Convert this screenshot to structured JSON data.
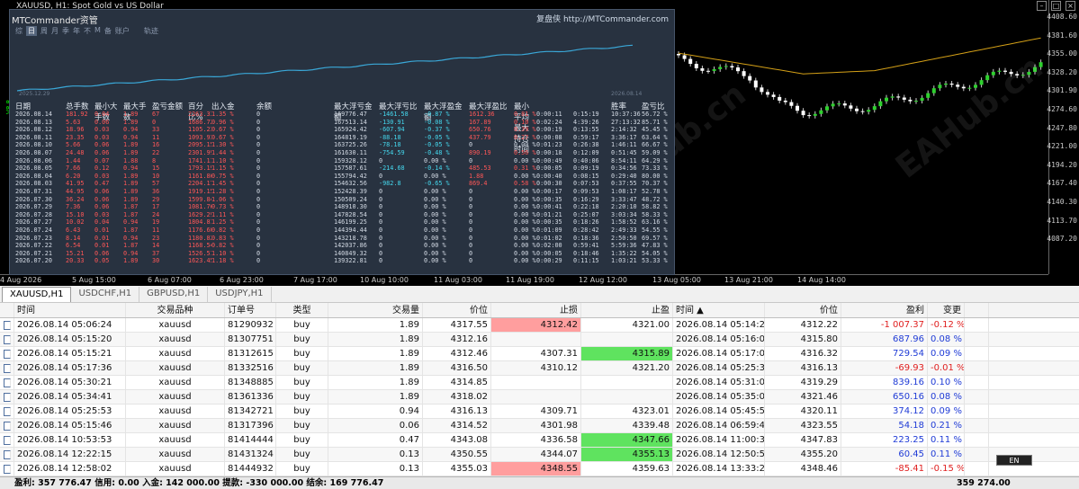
{
  "chart": {
    "title": "XAUUSD, H1:  Spot Gold vs US Dollar",
    "y_ticks": [
      "4408.60",
      "4381.60",
      "4355.00",
      "4328.20",
      "4301.90",
      "4274.60",
      "4247.80",
      "4221.00",
      "4194.20",
      "4167.40",
      "4140.30",
      "4113.70",
      "4087.20"
    ],
    "x_ticks": [
      "4 Aug 2026",
      "5 Aug 15:00",
      "6 Aug 07:00",
      "6 Aug 23:00",
      "7 Aug 17:00",
      "10 Aug 10:00",
      "11 Aug 03:00",
      "11 Aug 19:00",
      "12 Aug 12:00",
      "13 Aug 05:00",
      "13 Aug 21:00",
      "14 Aug 14:00"
    ],
    "watermark": "EAHub.cn",
    "left_tag": "V8.8"
  },
  "panel": {
    "brand": "MTCommander资管",
    "link": "复盘侠 http://MTCommander.com",
    "menu": [
      "综",
      "日",
      "周",
      "月",
      "季",
      "年",
      "不",
      "M",
      "备",
      "账户",
      "轨迹"
    ],
    "menu_active": "日",
    "eq_start": "2025.12.29",
    "eq_end": "2026.08.14",
    "headers": [
      "日期",
      "总手数",
      "最小大手数",
      "最大手数",
      "盈亏金额",
      "百分比%",
      "出入金",
      "余额",
      "最大浮亏金额",
      "最大浮亏比",
      "最大浮盈金额",
      "最大浮盈比",
      "最小平均最大持仓时间",
      "",
      "",
      "胜率",
      "盈亏比"
    ],
    "rows": [
      [
        "2026.08.14",
        "181.92",
        "0.04",
        "1.89",
        "67",
        "2263.33",
        "1.35 %",
        "0",
        "169776.47",
        "-1461.58",
        "-0.87 %",
        "1612.36",
        "0.81 %",
        "0:00:11",
        "0:15:19",
        "10:37:36",
        "56.72 %",
        "0.50"
      ],
      [
        "2026.08.13",
        "5.63",
        "0.06",
        "1.89",
        "0",
        "1686.72",
        "0.96 %",
        "0",
        "167513.14",
        "-130.91",
        "-0.08 %",
        "167.89",
        "0.10 %",
        "0:02:24",
        "4:39:26",
        "27:13:32",
        "85.71 %",
        "0.17"
      ],
      [
        "2026.08.12",
        "18.96",
        "0.03",
        "0.94",
        "33",
        "1105.23",
        "0.67 %",
        "0",
        "165924.42",
        "-607.94",
        "-0.37 %",
        "650.76",
        "0.39 %",
        "0:00:19",
        "0:13:55",
        "2:14:32",
        "45.45 %",
        "1.05"
      ],
      [
        "2026.08.11",
        "23.35",
        "0.03",
        "0.94",
        "11",
        "1093.93",
        "0.67 %",
        "0",
        "164819.19",
        "-88.18",
        "-0.05 %",
        "437.79",
        "0.27 %",
        "0:00:08",
        "0:59:17",
        "3:36:17",
        "63.64 %",
        "1.67"
      ],
      [
        "2026.08.10",
        "5.66",
        "0.06",
        "1.89",
        "16",
        "2095.15",
        "1.30 %",
        "0",
        "163725.26",
        "-78.18",
        "-0.05 %",
        "0",
        "0.00 %",
        "0:01:23",
        "0:26:38",
        "1:46:11",
        "66.67 %",
        "1.13"
      ],
      [
        "2026.08.07",
        "24.48",
        "0.06",
        "1.89",
        "22",
        "2301.99",
        "1.44 %",
        "0",
        "161630.11",
        "-754.59",
        "-0.48 %",
        "890.19",
        "0.56 %",
        "0:00:18",
        "0:12:09",
        "0:51:45",
        "59.09 %",
        "1.20"
      ],
      [
        "2026.08.06",
        "1.44",
        "0.07",
        "1.88",
        "8",
        "1741.11",
        "1.10 %",
        "0",
        "159328.12",
        "0",
        "0.00 %",
        "0",
        "0.00 %",
        "0:00:49",
        "0:40:06",
        "8:54:11",
        "64.29 %",
        "1.00"
      ],
      [
        "2026.08.05",
        "7.66",
        "0.12",
        "0.94",
        "15",
        "1793.19",
        "1.15 %",
        "0",
        "157587.61",
        "-214.68",
        "-0.14 %",
        "485.53",
        "0.31 %",
        "0:00:05",
        "0:09:19",
        "0:34:56",
        "73.33 %",
        "8.24"
      ],
      [
        "2026.08.04",
        "6.20",
        "0.03",
        "1.89",
        "10",
        "1161.86",
        "0.75 %",
        "0",
        "155794.42",
        "0",
        "0.00 %",
        "1.88",
        "0.00 %",
        "0:00:40",
        "0:08:15",
        "0:29:40",
        "80.00 %",
        "0.45"
      ],
      [
        "2026.08.03",
        "41.95",
        "0.47",
        "1.89",
        "57",
        "2204.17",
        "1.45 %",
        "0",
        "154632.56",
        "-982.8",
        "-0.65 %",
        "869.4",
        "0.58 %",
        "0:00:30",
        "0:07:53",
        "0:37:55",
        "70.37 %",
        "0.56"
      ],
      [
        "2026.07.31",
        "44.95",
        "0.06",
        "1.89",
        "36",
        "1919.15",
        "1.28 %",
        "0",
        "152428.39",
        "0",
        "0.00 %",
        "0",
        "0.00 %",
        "0:00:17",
        "0:09:53",
        "1:08:17",
        "52.78 %",
        "0.54"
      ],
      [
        "2026.07.30",
        "36.24",
        "0.06",
        "1.89",
        "29",
        "1599.84",
        "1.06 %",
        "0",
        "150509.24",
        "0",
        "0.00 %",
        "0",
        "0.00 %",
        "0:00:35",
        "0:16:29",
        "3:33:47",
        "48.72 %",
        "0.61"
      ],
      [
        "2026.07.29",
        "7.36",
        "0.06",
        "1.87",
        "17",
        "1081.76",
        "0.73 %",
        "0",
        "148910.30",
        "0",
        "0.00 %",
        "0",
        "0.00 %",
        "0:00:41",
        "0:22:18",
        "2:20:10",
        "58.82 %",
        "0.61"
      ],
      [
        "2026.07.28",
        "15.10",
        "0.03",
        "1.87",
        "24",
        "1629.29",
        "1.11 %",
        "0",
        "147828.54",
        "0",
        "0.00 %",
        "0",
        "0.00 %",
        "0:01:21",
        "0:25:07",
        "3:03:34",
        "58.33 %",
        "0.47"
      ],
      [
        "2026.07.27",
        "10.02",
        "0.04",
        "0.94",
        "19",
        "1804.81",
        "1.25 %",
        "0",
        "146199.25",
        "0",
        "0.00 %",
        "0",
        "0.00 %",
        "0:00:35",
        "0:18:26",
        "1:58:52",
        "63.16 %",
        "0.52"
      ],
      [
        "2026.07.24",
        "6.43",
        "0.01",
        "1.87",
        "11",
        "1176.60",
        "0.82 %",
        "0",
        "144394.44",
        "0",
        "0.00 %",
        "0",
        "0.00 %",
        "0:01:09",
        "0:28:42",
        "2:49:33",
        "54.55 %",
        "0.76"
      ],
      [
        "2026.07.23",
        "8.14",
        "0.01",
        "0.94",
        "23",
        "1180.82",
        "0.83 %",
        "0",
        "143218.78",
        "0",
        "0.00 %",
        "0",
        "0.00 %",
        "0:01:02",
        "0:18:36",
        "2:50:50",
        "69.57 %",
        "0.71"
      ],
      [
        "2026.07.22",
        "6.54",
        "0.01",
        "1.87",
        "14",
        "1168.54",
        "0.82 %",
        "0",
        "142037.86",
        "0",
        "0.00 %",
        "0",
        "0.00 %",
        "0:02:00",
        "0:59:41",
        "5:59:36",
        "47.83 %",
        "0.66"
      ],
      [
        "2026.07.21",
        "15.21",
        "0.06",
        "0.94",
        "37",
        "1526.51",
        "1.10 %",
        "0",
        "140849.32",
        "0",
        "0.00 %",
        "0",
        "0.00 %",
        "0:00:05",
        "0:18:46",
        "1:35:22",
        "54.05 %",
        "0.78"
      ],
      [
        "2026.07.20",
        "20.33",
        "0.05",
        "1.89",
        "30",
        "1623.45",
        "1.18 %",
        "0",
        "139322.81",
        "0",
        "0.00 %",
        "0",
        "0.00 %",
        "0:00:29",
        "0:11:15",
        "1:03:21",
        "53.33 %",
        "0.78"
      ]
    ]
  },
  "tabs": [
    "XAUUSD,H1",
    "USDCHF,H1",
    "GBPUSD,H1",
    "USDJPY,H1"
  ],
  "tabs_active": 0,
  "table": {
    "headers": [
      "时间",
      "交易品种",
      "订单号",
      "类型",
      "交易量",
      "价位",
      "止损",
      "止盈",
      "时间",
      "价位",
      "盈利",
      "变更"
    ],
    "sort_marker": "▲",
    "rows": [
      {
        "t": "2026.08.14 05:06:24",
        "s": "xauusd",
        "o": "81290932",
        "ty": "buy",
        "v": "1.89",
        "p": "4317.55",
        "sl": "4312.42",
        "tp": "4321.00",
        "ct": "2026.08.14 05:14:26",
        "cp": "4312.22",
        "pr": "-1 007.37",
        "ch": "-0.12 %",
        "slbg": "red",
        "tpbg": "",
        "pos": false
      },
      {
        "t": "2026.08.14 05:15:20",
        "s": "xauusd",
        "o": "81307751",
        "ty": "buy",
        "v": "1.89",
        "p": "4312.16",
        "sl": "",
        "tp": "",
        "ct": "2026.08.14 05:16:07",
        "cp": "4315.80",
        "pr": "687.96",
        "ch": "0.08 %",
        "slbg": "",
        "tpbg": "",
        "pos": true
      },
      {
        "t": "2026.08.14 05:15:21",
        "s": "xauusd",
        "o": "81312615",
        "ty": "buy",
        "v": "1.89",
        "p": "4312.46",
        "sl": "4307.31",
        "tp": "4315.89",
        "ct": "2026.08.14 05:17:05",
        "cp": "4316.32",
        "pr": "729.54",
        "ch": "0.09 %",
        "slbg": "",
        "tpbg": "green",
        "pos": true
      },
      {
        "t": "2026.08.14 05:17:36",
        "s": "xauusd",
        "o": "81332516",
        "ty": "buy",
        "v": "1.89",
        "p": "4316.50",
        "sl": "4310.12",
        "tp": "4321.20",
        "ct": "2026.08.14 05:25:36",
        "cp": "4316.13",
        "pr": "-69.93",
        "ch": "-0.01 %",
        "slbg": "",
        "tpbg": "",
        "pos": false
      },
      {
        "t": "2026.08.14 05:30:21",
        "s": "xauusd",
        "o": "81348885",
        "ty": "buy",
        "v": "1.89",
        "p": "4314.85",
        "sl": "",
        "tp": "",
        "ct": "2026.08.14 05:31:01",
        "cp": "4319.29",
        "pr": "839.16",
        "ch": "0.10 %",
        "slbg": "",
        "tpbg": "",
        "pos": true
      },
      {
        "t": "2026.08.14 05:34:41",
        "s": "xauusd",
        "o": "81361336",
        "ty": "buy",
        "v": "1.89",
        "p": "4318.02",
        "sl": "",
        "tp": "",
        "ct": "2026.08.14 05:35:02",
        "cp": "4321.46",
        "pr": "650.16",
        "ch": "0.08 %",
        "slbg": "",
        "tpbg": "",
        "pos": true
      },
      {
        "t": "2026.08.14 05:25:53",
        "s": "xauusd",
        "o": "81342721",
        "ty": "buy",
        "v": "0.94",
        "p": "4316.13",
        "sl": "4309.71",
        "tp": "4323.01",
        "ct": "2026.08.14 05:45:58",
        "cp": "4320.11",
        "pr": "374.12",
        "ch": "0.09 %",
        "slbg": "",
        "tpbg": "",
        "pos": true
      },
      {
        "t": "2026.08.14 05:15:46",
        "s": "xauusd",
        "o": "81317396",
        "ty": "buy",
        "v": "0.06",
        "p": "4314.52",
        "sl": "4301.98",
        "tp": "4339.48",
        "ct": "2026.08.14 06:59:44",
        "cp": "4323.55",
        "pr": "54.18",
        "ch": "0.21 %",
        "slbg": "",
        "tpbg": "",
        "pos": true
      },
      {
        "t": "2026.08.14 10:53:53",
        "s": "xauusd",
        "o": "81414444",
        "ty": "buy",
        "v": "0.47",
        "p": "4343.08",
        "sl": "4336.58",
        "tp": "4347.66",
        "ct": "2026.08.14 11:00:30",
        "cp": "4347.83",
        "pr": "223.25",
        "ch": "0.11 %",
        "slbg": "",
        "tpbg": "green",
        "pos": true
      },
      {
        "t": "2026.08.14 12:22:15",
        "s": "xauusd",
        "o": "81431324",
        "ty": "buy",
        "v": "0.13",
        "p": "4350.55",
        "sl": "4344.07",
        "tp": "4355.13",
        "ct": "2026.08.14 12:50:51",
        "cp": "4355.20",
        "pr": "60.45",
        "ch": "0.11 %",
        "slbg": "",
        "tpbg": "green",
        "pos": true
      },
      {
        "t": "2026.08.14 12:58:02",
        "s": "xauusd",
        "o": "81444932",
        "ty": "buy",
        "v": "0.13",
        "p": "4355.03",
        "sl": "4348.55",
        "tp": "4359.63",
        "ct": "2026.08.14 13:33:29",
        "cp": "4348.46",
        "pr": "-85.41",
        "ch": "-0.15 %",
        "slbg": "red",
        "tpbg": "",
        "pos": false
      }
    ]
  },
  "footer": {
    "summary": "盈利: 357 776.47  信用: 0.00  入金: 142 000.00  提款: -330 000.00  结余: 169 776.47",
    "total": "359 274.00"
  },
  "badge": "EN"
}
